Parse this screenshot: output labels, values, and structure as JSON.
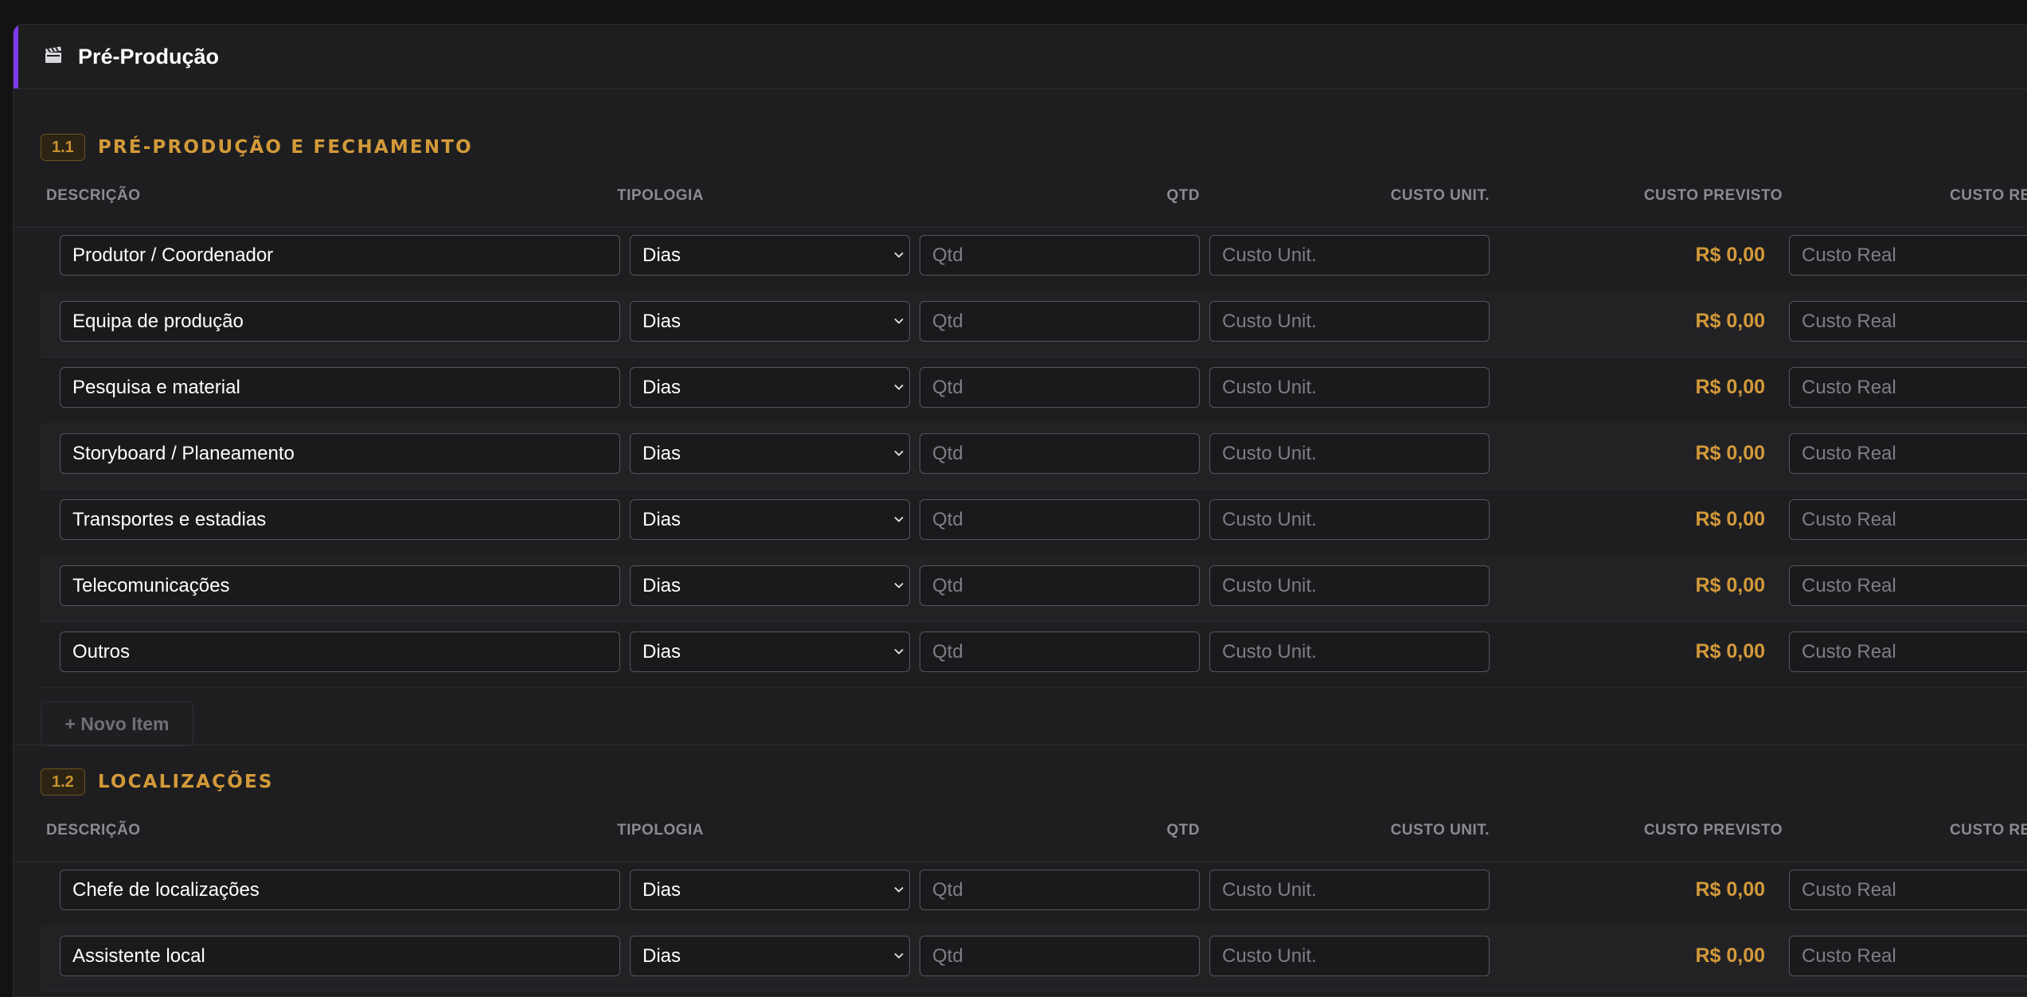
{
  "panel": {
    "title": "Pré-Produção",
    "icon": "clapperboard-icon",
    "accent_color": "#7c3aed"
  },
  "columns": {
    "descricao": "DESCRIÇÃO",
    "tipologia": "TIPOLOGIA",
    "qtd": "QTD",
    "custo_unit": "CUSTO UNIT.",
    "custo_previsto": "CUSTO PREVISTO",
    "custo_real": "CUSTO RE"
  },
  "placeholders": {
    "qtd": "Qtd",
    "custo_unit": "Custo Unit.",
    "custo_real": "Custo Real"
  },
  "sections": [
    {
      "badge": "1.1",
      "title": "PRÉ-PRODUÇÃO E FECHAMENTO",
      "new_item_label": "+ Novo Item",
      "rows": [
        {
          "descricao": "Produtor / Coordenador",
          "tipologia": "Dias",
          "custo_previsto": "R$ 0,00"
        },
        {
          "descricao": "Equipa de produção",
          "tipologia": "Dias",
          "custo_previsto": "R$ 0,00"
        },
        {
          "descricao": "Pesquisa e material",
          "tipologia": "Dias",
          "custo_previsto": "R$ 0,00"
        },
        {
          "descricao": "Storyboard / Planeamento",
          "tipologia": "Dias",
          "custo_previsto": "R$ 0,00"
        },
        {
          "descricao": "Transportes e estadias",
          "tipologia": "Dias",
          "custo_previsto": "R$ 0,00"
        },
        {
          "descricao": "Telecomunicações",
          "tipologia": "Dias",
          "custo_previsto": "R$ 0,00"
        },
        {
          "descricao": "Outros",
          "tipologia": "Dias",
          "custo_previsto": "R$ 0,00"
        }
      ]
    },
    {
      "badge": "1.2",
      "title": "LOCALIZAÇÕES",
      "rows": [
        {
          "descricao": "Chefe de localizações",
          "tipologia": "Dias",
          "custo_previsto": "R$ 0,00"
        },
        {
          "descricao": "Assistente local",
          "tipologia": "Dias",
          "custo_previsto": "R$ 0,00"
        }
      ]
    }
  ],
  "colors": {
    "accent": "#d39a3a",
    "bg": "#1e1e20",
    "purple": "#7c3aed"
  }
}
